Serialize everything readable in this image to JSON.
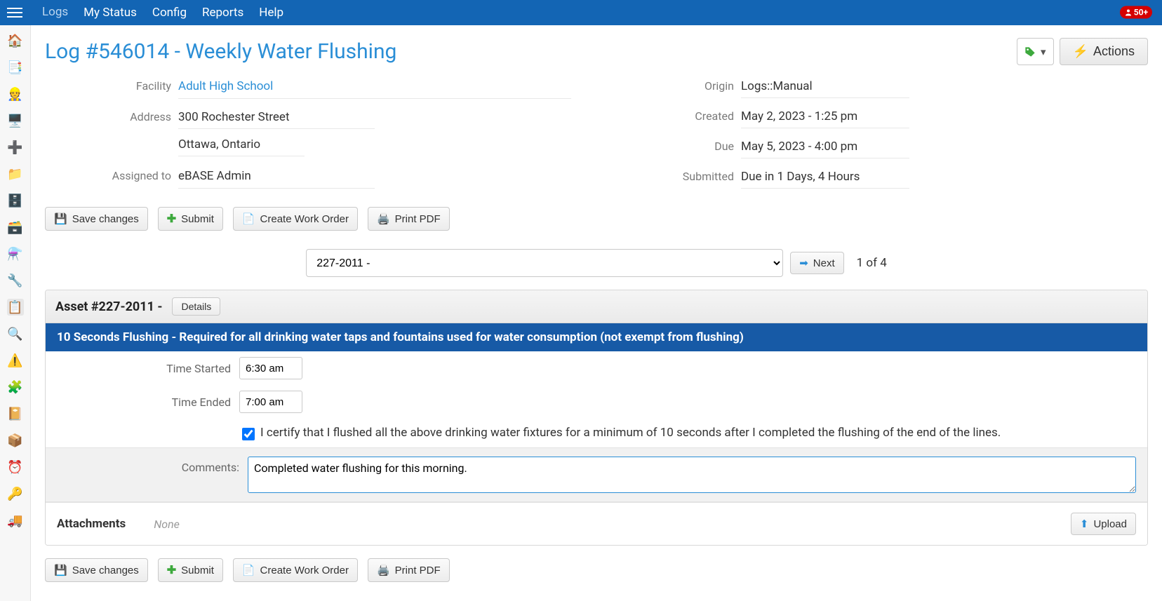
{
  "topnav": {
    "items": [
      "Logs",
      "My Status",
      "Config",
      "Reports",
      "Help"
    ],
    "active_index": 0
  },
  "notifications": {
    "count_label": "50+"
  },
  "page_title": "Log #546014 - Weekly Water Flushing",
  "title_actions": {
    "actions_label": "Actions"
  },
  "info_left": {
    "facility_label": "Facility",
    "facility_value": "Adult High School",
    "address_label": "Address",
    "address_line1": "300 Rochester Street",
    "address_line2": "Ottawa, Ontario",
    "assigned_label": "Assigned to",
    "assigned_value": "eBASE Admin"
  },
  "info_right": {
    "origin_label": "Origin",
    "origin_value": "Logs::Manual",
    "created_label": "Created",
    "created_value": "May 2, 2023 - 1:25 pm",
    "due_label": "Due",
    "due_value": "May 5, 2023 - 4:00 pm",
    "submitted_label": "Submitted",
    "submitted_value": "Due in 1 Days, 4 Hours"
  },
  "buttons": {
    "save": "Save changes",
    "submit": "Submit",
    "create_wo": "Create Work Order",
    "print_pdf": "Print PDF",
    "next": "Next",
    "details": "Details",
    "upload": "Upload"
  },
  "asset_selector": {
    "value": "227-2011 -",
    "pager": "1 of 4"
  },
  "asset_panel": {
    "title": "Asset #227-2011 -",
    "task_heading": "10 Seconds Flushing - Required for all drinking water taps and fountains used for water consumption (not exempt from flushing)",
    "time_started_label": "Time Started",
    "time_started_value": "6:30 am",
    "time_ended_label": "Time Ended",
    "time_ended_value": "7:00 am",
    "cert_checked": true,
    "cert_text": "I certify that I flushed all the above drinking water fixtures for a minimum of 10 seconds after I completed the flushing of the end of the lines.",
    "comments_label": "Comments:",
    "comments_value": "Completed water flushing for this morning.",
    "attachments_label": "Attachments",
    "attachments_none": "None"
  }
}
